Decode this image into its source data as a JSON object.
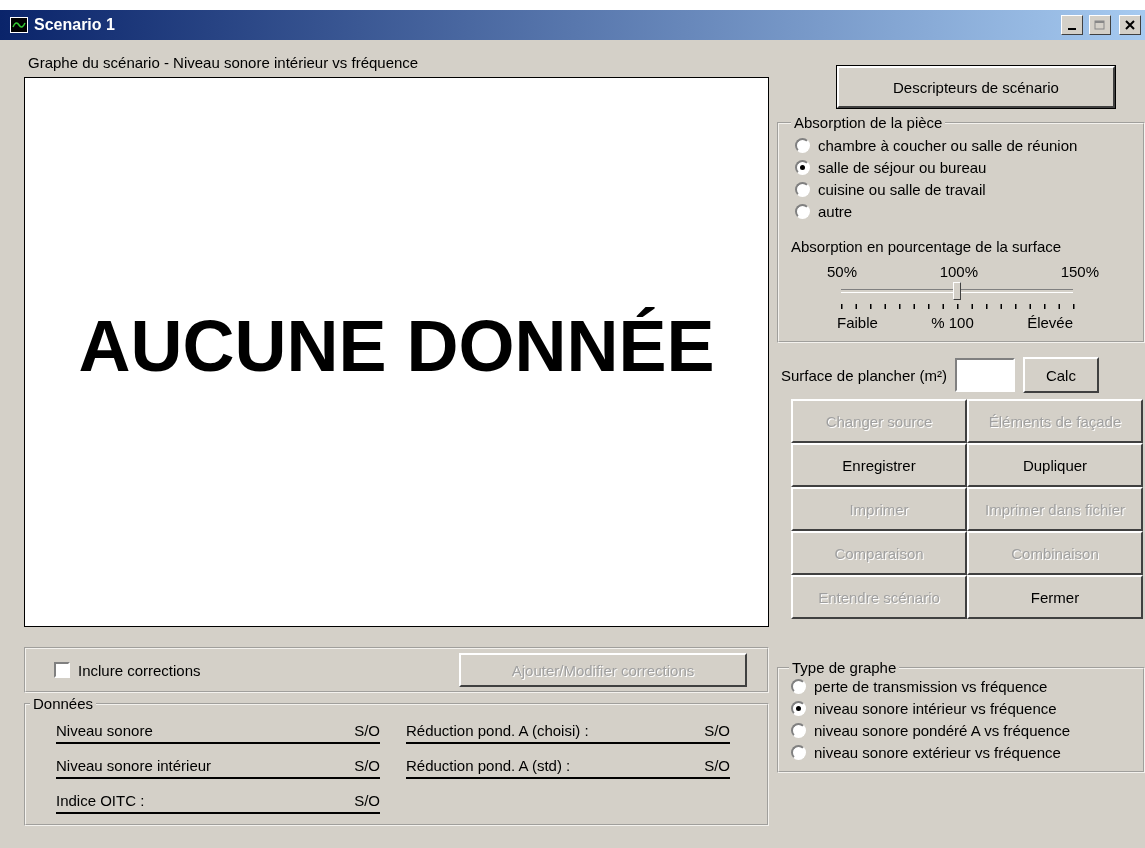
{
  "window": {
    "title": "Scenario 1"
  },
  "graph": {
    "caption": "Graphe du scénario - Niveau sonore intérieur vs fréquence",
    "message": "AUCUNE DONNÉE"
  },
  "corrections": {
    "include": {
      "label": "Inclure corrections",
      "checked": false
    },
    "button": {
      "label": "Ajouter/Modifier corrections",
      "disabled": true
    }
  },
  "donnees": {
    "title": "Données",
    "left": [
      {
        "label": "Niveau sonore",
        "value": "S/O"
      },
      {
        "label": "Niveau sonore intérieur",
        "value": "S/O"
      },
      {
        "label": "Indice OITC :",
        "value": "S/O"
      }
    ],
    "right": [
      {
        "label": "Réduction  pond. A (choisi) :",
        "value": "S/O"
      },
      {
        "label": "Réduction pond. A (std) :",
        "value": "S/O"
      }
    ]
  },
  "descriptors_button": {
    "label": "Descripteurs de scénario"
  },
  "absorption": {
    "title": "Absorption de la pièce",
    "options": [
      {
        "label": "chambre à coucher ou salle de réunion",
        "selected": false
      },
      {
        "label": "salle de séjour ou bureau",
        "selected": true
      },
      {
        "label": "cuisine ou salle de travail",
        "selected": false
      },
      {
        "label": "autre",
        "selected": false
      }
    ],
    "slider": {
      "title": "Absorption en pourcentage de la surface",
      "top_labels": [
        "50%",
        "100%",
        "150%"
      ],
      "level": 0.5,
      "bottom_labels": [
        "Faible",
        "% 100",
        "Élevée"
      ]
    }
  },
  "floor_area": {
    "label": "Surface de plancher (m²)",
    "button": "Calc"
  },
  "actions": [
    {
      "label": "Changer source",
      "disabled": true
    },
    {
      "label": "Éléments de façade",
      "disabled": true
    },
    {
      "label": "Enregistrer",
      "disabled": false
    },
    {
      "label": "Dupliquer",
      "disabled": false
    },
    {
      "label": "Imprimer",
      "disabled": true
    },
    {
      "label": "Imprimer dans fichier",
      "disabled": true
    },
    {
      "label": "Comparaison",
      "disabled": true
    },
    {
      "label": "Combinaison",
      "disabled": true
    },
    {
      "label": "Entendre scénario",
      "disabled": true
    },
    {
      "label": "Fermer",
      "disabled": false
    }
  ],
  "graph_type": {
    "title": "Type de graphe",
    "options": [
      {
        "label": "perte de transmission vs fréquence",
        "selected": false
      },
      {
        "label": "niveau sonore intérieur vs fréquence",
        "selected": true
      },
      {
        "label": "niveau sonore pondéré A vs fréquence",
        "selected": false
      },
      {
        "label": "niveau sonore extérieur vs fréquence",
        "selected": false
      }
    ]
  }
}
